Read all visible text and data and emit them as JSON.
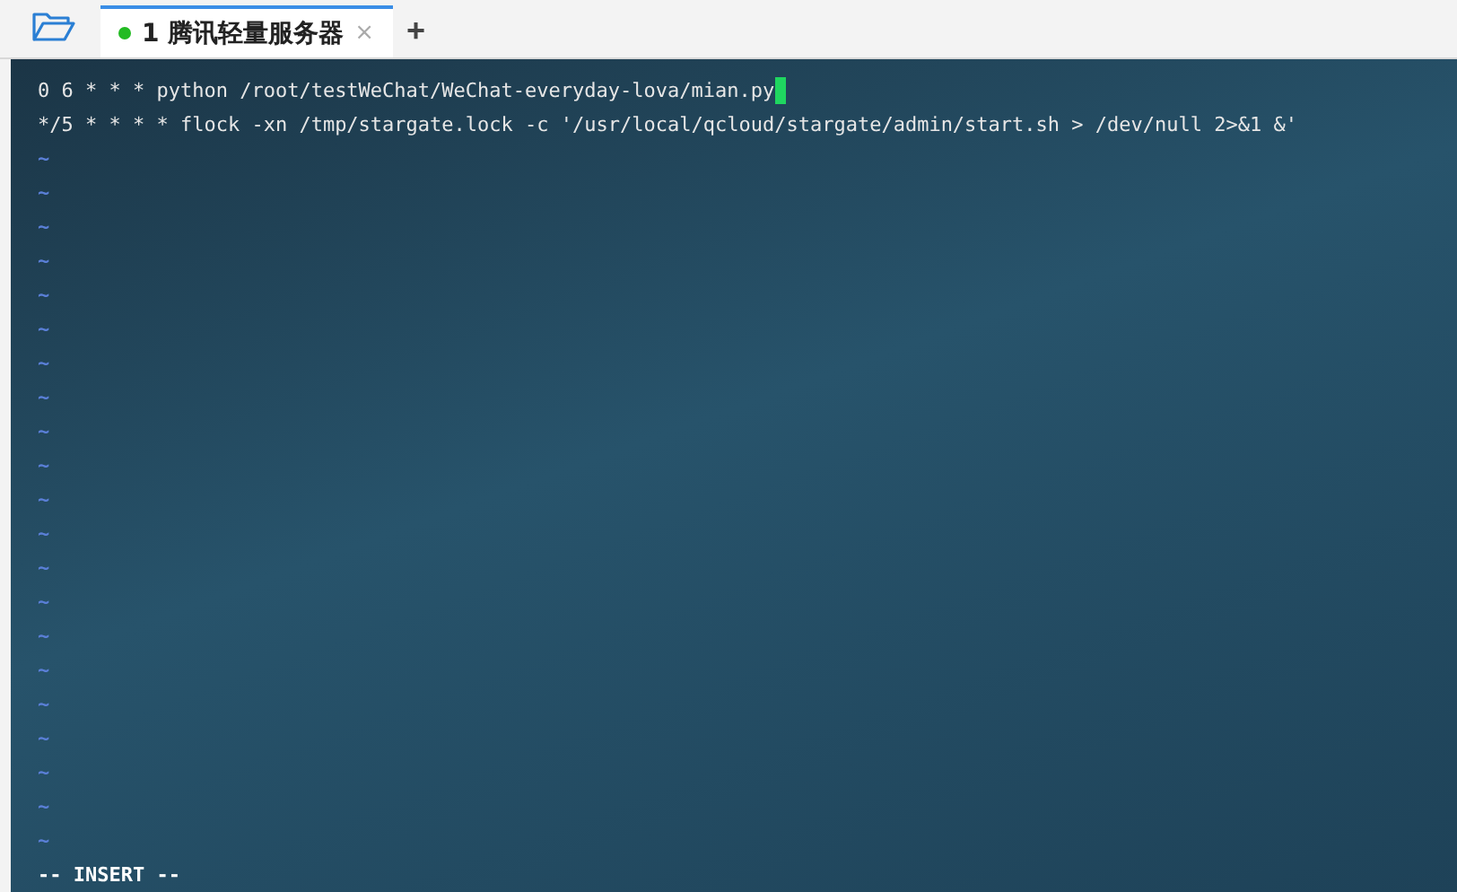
{
  "tabs": [
    {
      "color": "#22bb22",
      "label": "1 腾讯轻量服务器",
      "close": "×",
      "selected": true
    }
  ],
  "new_tab": "+",
  "editor": {
    "lines": [
      {
        "text": "0 6 * * * python /root/testWeChat/WeChat-everyday-lova/mian.py",
        "cursor": true
      },
      {
        "text": "*/5 * * * * flock -xn /tmp/stargate.lock -c '/usr/local/qcloud/stargate/admin/start.sh > /dev/null 2>&1 &'",
        "cursor": false
      }
    ],
    "empty_markers": [
      "~",
      "~",
      "~",
      "~",
      "~",
      "~",
      "~",
      "~",
      "~",
      "~",
      "~",
      "~",
      "~",
      "~",
      "~",
      "~",
      "~",
      "~",
      "~",
      "~",
      "~"
    ],
    "mode": "-- INSERT --"
  }
}
